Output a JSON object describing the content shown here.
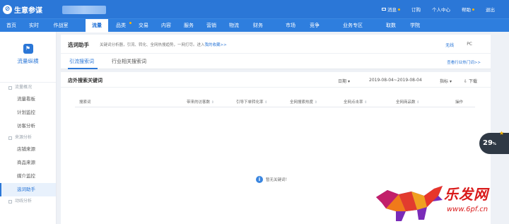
{
  "topbar": {
    "brand": "生意参谋",
    "links": [
      {
        "label": "消息"
      },
      {
        "label": "订购"
      },
      {
        "label": "个人中心"
      },
      {
        "label": "帮助"
      },
      {
        "label": "退出"
      }
    ]
  },
  "nav": {
    "items": [
      "首页",
      "实时",
      "作战室",
      "流量",
      "品类",
      "交易",
      "内容",
      "服务",
      "营销",
      "物流",
      "财务",
      "市场",
      "竞争",
      "业务专区",
      "取数",
      "学院"
    ]
  },
  "sidebar": {
    "title": "流量纵横",
    "groups": [
      {
        "label": "流量概况",
        "items": [
          "流量看板",
          "计划监控",
          "访客分析"
        ]
      },
      {
        "label": "来源分析",
        "items": [
          "店铺来源",
          "商品来源",
          "媒介监控",
          "选词助手"
        ]
      },
      {
        "label": "动线分析",
        "items": []
      }
    ]
  },
  "helper": {
    "title": "选词助手",
    "desc": "关键词分析器，引流、转化、全网热搜趋势，一网打尽。进入",
    "link": "我的收藏>>",
    "dev_tabs": [
      "无线",
      "PC"
    ]
  },
  "tabs": {
    "items": [
      "引流搜索词",
      "行业相关搜索词"
    ],
    "more": "查看行业热门词>>"
  },
  "panel": {
    "title": "店外搜索关键词",
    "date_label": "日期",
    "date_range": "2019-08-04~2019-08-04",
    "indicator": "指标",
    "download": "下载",
    "columns": [
      "搜索词",
      "带来的访客数",
      "引导下单转化率",
      "全网搜索热度",
      "全网点击率",
      "全网商品数",
      "操作"
    ],
    "empty_text": "暂无关键词！"
  },
  "float": {
    "value": "29",
    "unit": "%"
  },
  "watermark": {
    "title": "乐发网",
    "url": "www.6pf.cn"
  },
  "colors": {
    "brand": "#2b77d7",
    "accent": "#ffb400",
    "watermark": "#d91b1b"
  }
}
